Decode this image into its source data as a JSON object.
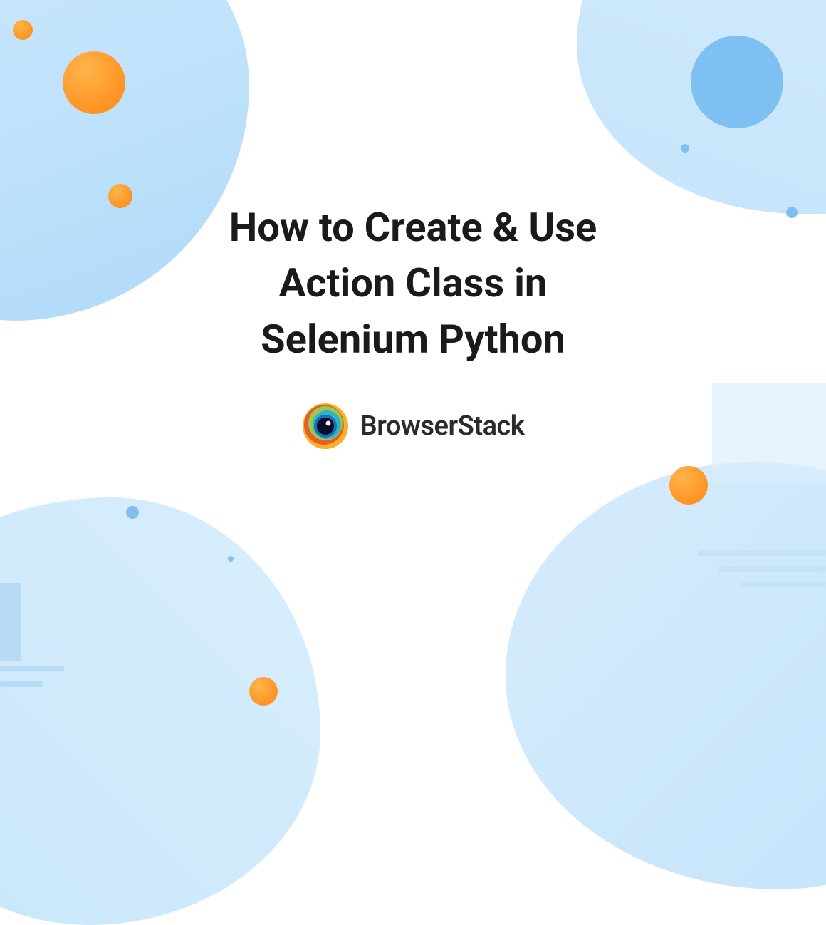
{
  "hero": {
    "title_line1": "How to Create & Use",
    "title_line2": "Action Class in",
    "title_line3": "Selenium Python",
    "brand_name": "BrowserStack"
  },
  "colors": {
    "orange": "#ff9a2b",
    "blue_light": "#c3e3fb",
    "blue_circle": "#7fc0f2",
    "text": "#1a1a1a"
  }
}
